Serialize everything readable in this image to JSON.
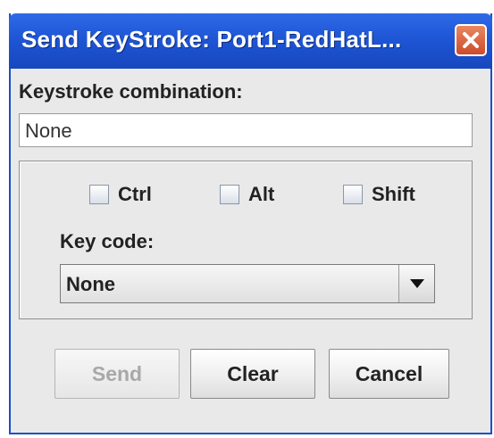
{
  "window": {
    "title": "Send KeyStroke: Port1-RedHatL...",
    "close_icon": "close-icon"
  },
  "combination": {
    "label": "Keystroke combination:",
    "value": "None"
  },
  "modifiers": {
    "ctrl": {
      "label": "Ctrl",
      "checked": false
    },
    "alt": {
      "label": "Alt",
      "checked": false
    },
    "shift": {
      "label": "Shift",
      "checked": false
    }
  },
  "keycode": {
    "label": "Key code:",
    "selected": "None",
    "dropdown_icon": "chevron-down-icon"
  },
  "buttons": {
    "send": {
      "label": "Send",
      "enabled": false
    },
    "clear": {
      "label": "Clear",
      "enabled": true
    },
    "cancel": {
      "label": "Cancel",
      "enabled": true
    }
  },
  "colors": {
    "titlebar": "#1e56d6",
    "close_button": "#d6572f",
    "dialog_background": "#e9e9e9"
  }
}
